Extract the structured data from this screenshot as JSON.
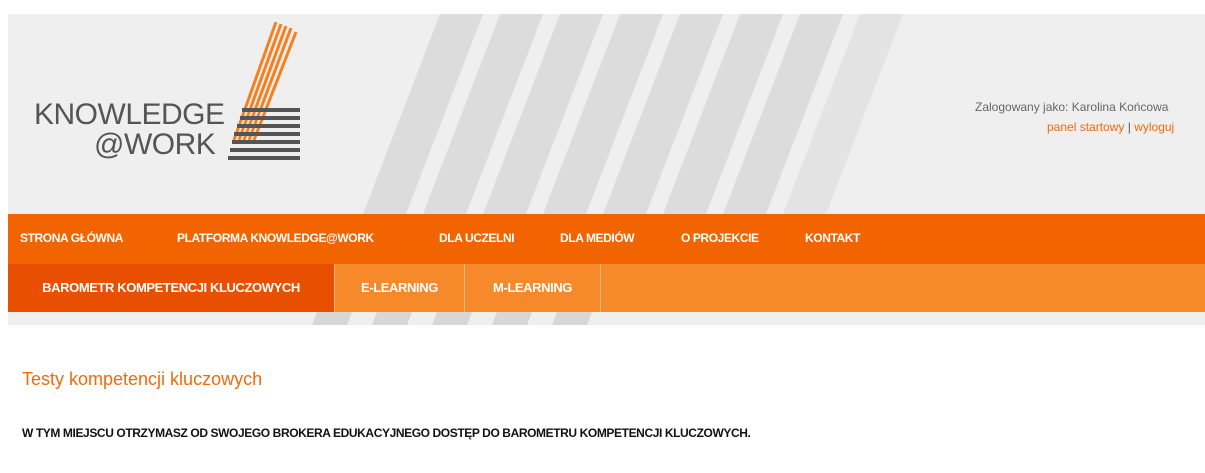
{
  "brand": {
    "logo_line1": "KNOWLEDGE",
    "logo_line2": "@WORK",
    "logo_icon": "stacked-lines-logo-icon"
  },
  "user": {
    "logged_in_label": "Zalogowany jako: Karolina Końcowa",
    "links": [
      "panel startowy",
      "wyloguj"
    ],
    "separator": "|"
  },
  "main_nav": {
    "items": [
      "STRONA GŁÓWNA",
      "PLATFORMA KNOWLEDGE@WORK",
      "DLA UCZELNI",
      "DLA MEDIÓW",
      "O PROJEKCIE",
      "KONTAKT"
    ]
  },
  "sub_nav": {
    "tabs": [
      "BAROMETR KOMPETENCJI KLUCZOWYCH",
      "E-LEARNING",
      "M-LEARNING"
    ],
    "active": "BAROMETR KOMPETENCJI KLUCZOWYCH"
  },
  "content": {
    "title": "Testy kompetencji kluczowych",
    "lead": "W TYM MIEJSCU OTRZYMASZ OD SWOJEGO BROKERA EDUKACYJNEGO DOSTĘP DO BAROMETRU KOMPETENCJI KLUCZOWYCH."
  },
  "colors": {
    "accent": "#f26400",
    "subnav": "#f68a2a",
    "active_tab": "#e85000",
    "header_bg": "#efefef"
  }
}
